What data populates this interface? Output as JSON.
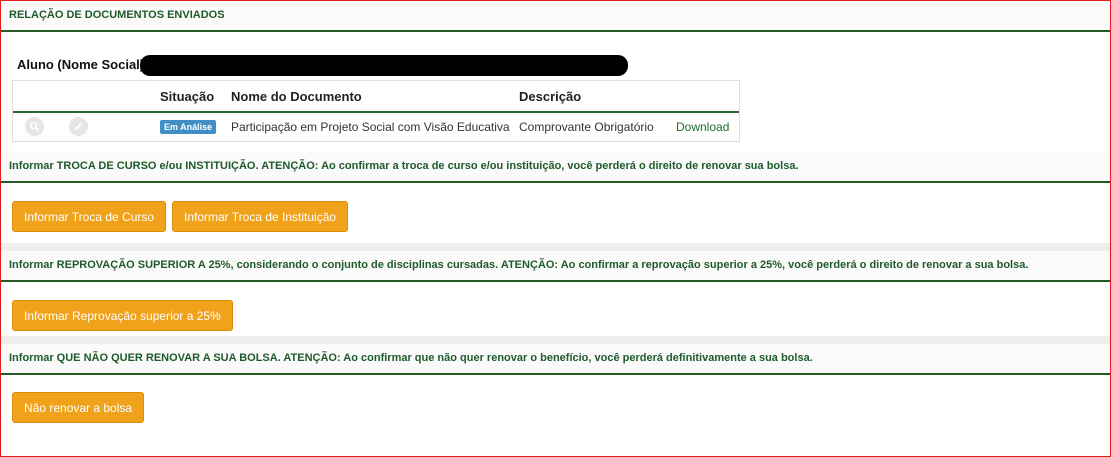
{
  "panel": {
    "title": "RELAÇÃO DE DOCUMENTOS ENVIADOS"
  },
  "student": {
    "label": "Aluno (Nome Social)"
  },
  "documents": {
    "columns": {
      "situacao": "Situação",
      "nome": "Nome do Documento",
      "descricao": "Descrição"
    },
    "rows": [
      {
        "status": "Em Análise",
        "name": "Participação em Projeto Social com Visão Educativa",
        "description": "Comprovante Obrigatório",
        "action": "Download"
      }
    ]
  },
  "sections": {
    "troca": {
      "text": "Informar TROCA DE CURSO e/ou INSTITUIÇÃO. ATENÇÃO: Ao confirmar a troca de curso e/ou instituição, você perderá o direito de renovar sua bolsa.",
      "buttons": [
        "Informar Troca de Curso",
        "Informar Troca de Instituição"
      ]
    },
    "reprovacao": {
      "text": "Informar REPROVAÇÃO SUPERIOR A 25%, considerando o conjunto de disciplinas cursadas. ATENÇÃO: Ao confirmar a reprovação superior a 25%, você perderá o direito de renovar a sua bolsa.",
      "button": "Informar Reprovação superior a 25%"
    },
    "nao_renovar": {
      "text": "Informar QUE NÃO QUER RENOVAR A SUA BOLSA. ATENÇÃO: Ao confirmar que não quer renovar o benefício, você perderá definitivamente a sua bolsa.",
      "button": "Não renovar a bolsa"
    }
  },
  "colors": {
    "accent": "#f0a21a",
    "title_green": "#1f5a2a",
    "badge_blue": "#3f8fc6",
    "frame_red": "#e21b1b"
  },
  "icons": [
    "search-icon",
    "edit-icon"
  ]
}
